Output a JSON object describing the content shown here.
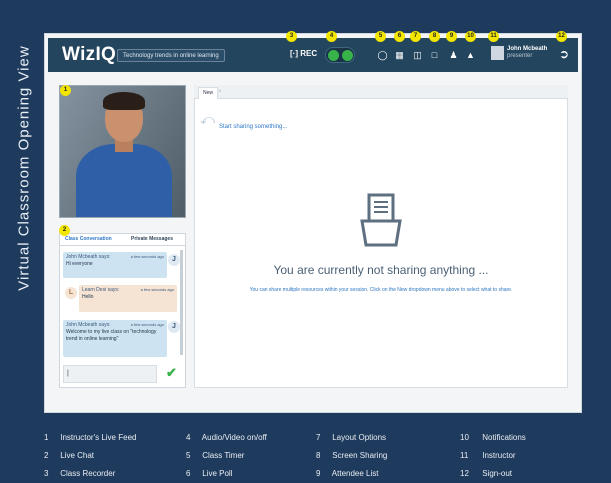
{
  "side_title": "Virtual Classroom Opening View",
  "app": {
    "logo": "WizIQ",
    "session_title": "Technology trends in online learning",
    "rec_label": "[·] REC",
    "presenter_name": "John Mcbeath",
    "presenter_role": "presenter"
  },
  "badges": [
    "1",
    "2",
    "3",
    "4",
    "5",
    "6",
    "7",
    "8",
    "9",
    "10",
    "11",
    "12"
  ],
  "chat": {
    "tab_conversation": "Class Conversation",
    "tab_private": "Private Messages",
    "messages": [
      {
        "author": "John Mcbeath says:",
        "time": "a few seconds ago",
        "text": "Hi everyone",
        "avatar": "J"
      },
      {
        "author": "Learn Desi says:",
        "time": "a few seconds ago",
        "text": "Hello",
        "avatar": "L"
      },
      {
        "author": "John Mcbeath says:",
        "time": "a few seconds ago",
        "text": "Welcome to my live class on \"technology trend in online learning\"",
        "avatar": "J"
      }
    ],
    "input_value": "|"
  },
  "board": {
    "tab_label": "New",
    "tab_close": "×",
    "start_text": "Start sharing something...",
    "empty_title": "You are currently not sharing anything ...",
    "empty_desc": "You can share multiple resources within your session. Click on the New dropdown menu above to select what to share."
  },
  "legend": [
    {
      "n": "1",
      "label": "Instructor's Live Feed"
    },
    {
      "n": "2",
      "label": "Live Chat"
    },
    {
      "n": "3",
      "label": "Class Recorder"
    },
    {
      "n": "4",
      "label": "Audio/Video on/off"
    },
    {
      "n": "5",
      "label": "Class Timer"
    },
    {
      "n": "6",
      "label": "Live Poll"
    },
    {
      "n": "7",
      "label": "Layout Options"
    },
    {
      "n": "8",
      "label": "Screen Sharing"
    },
    {
      "n": "9",
      "label": "Attendee List"
    },
    {
      "n": "10",
      "label": "Notifications"
    },
    {
      "n": "11",
      "label": "Instructor"
    },
    {
      "n": "12",
      "label": "Sign-out"
    }
  ],
  "icons": {
    "timer": "timer-icon",
    "poll": "poll-icon",
    "layout": "layout-icon",
    "screen": "screen-share-icon",
    "attendees": "attendee-list-icon",
    "bell": "notification-bell-icon",
    "signout": "sign-out-icon"
  },
  "colors": {
    "background": "#1e3a5c",
    "topbar": "#24455e",
    "badge": "#f2e500",
    "accent_green": "#37b34a",
    "link_blue": "#2f78c4"
  }
}
